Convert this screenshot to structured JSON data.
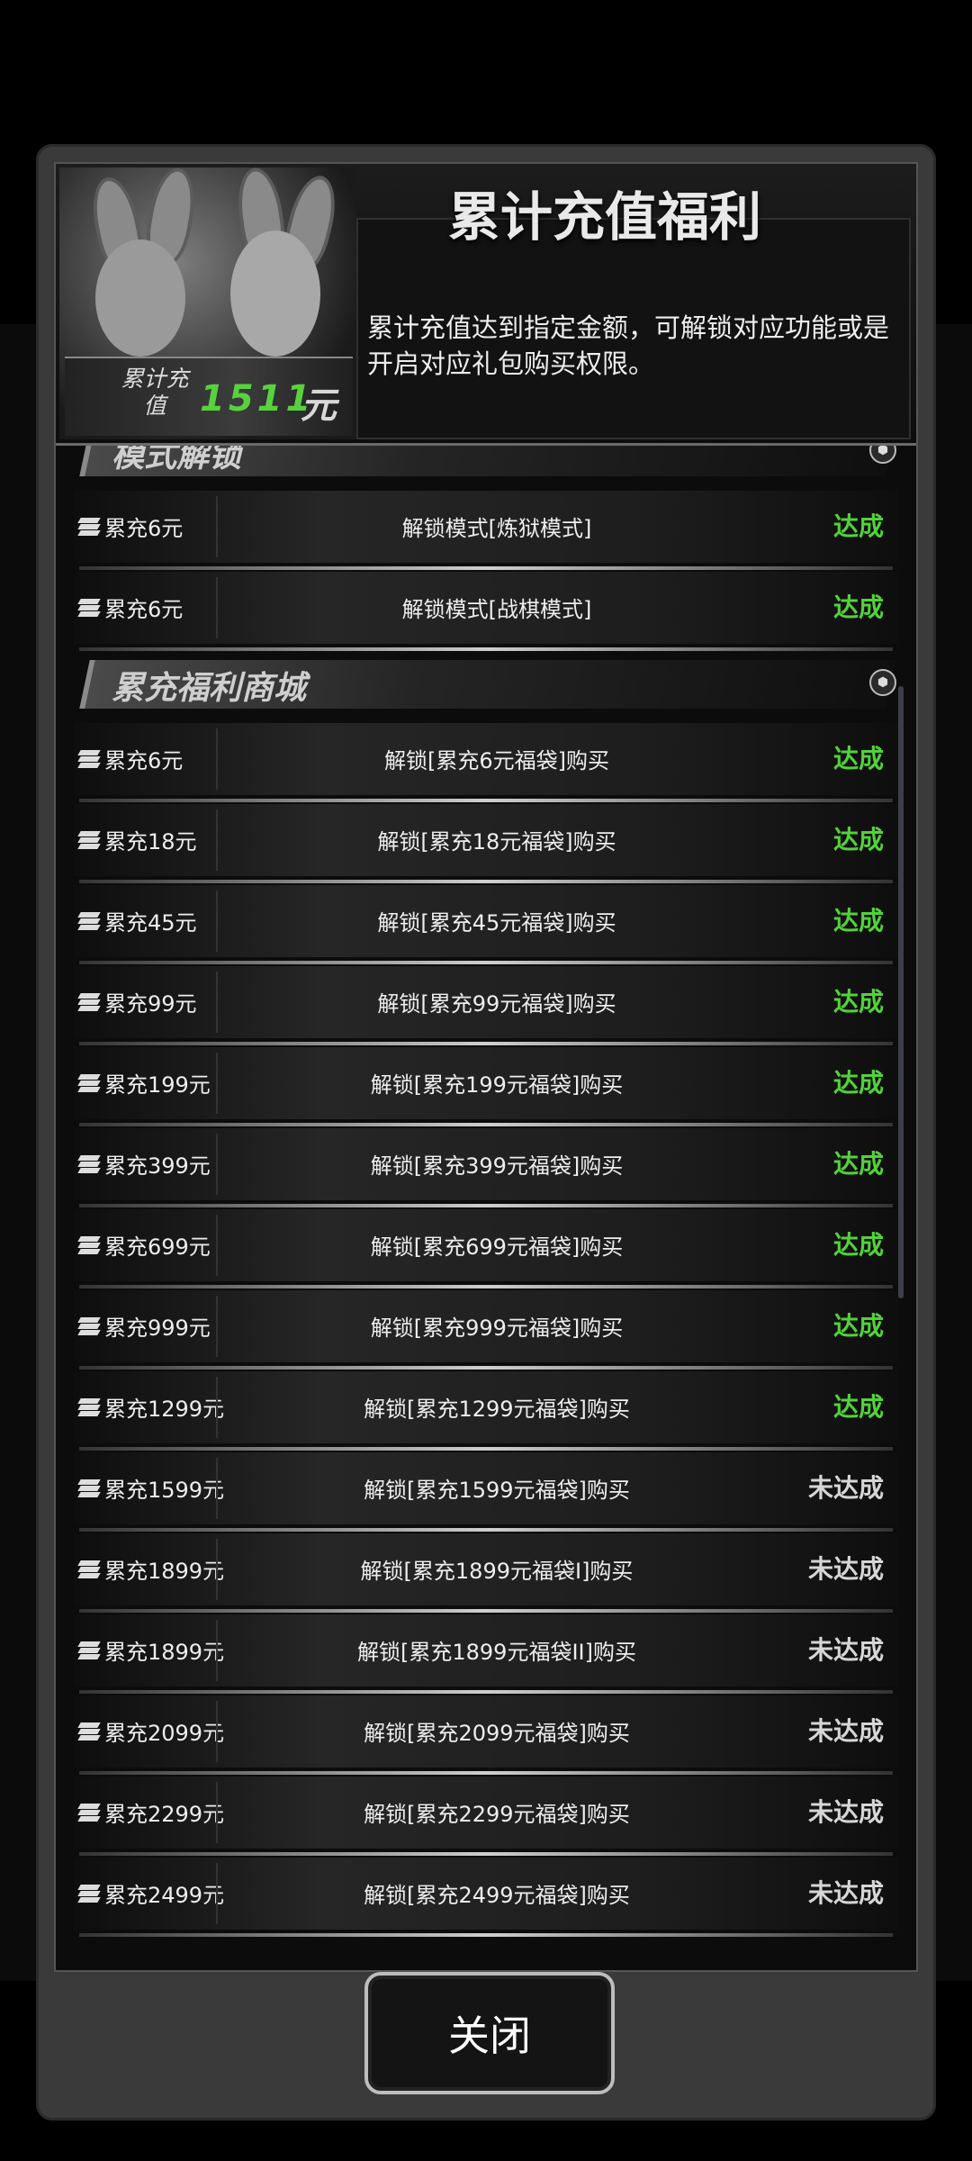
{
  "header": {
    "title": "累计充值福利",
    "description": "累计充值达到指定金额，可解锁对应功能或是开启对应礼包购买权限。",
    "recharge_label": "累计充值",
    "recharge_value": "1511",
    "recharge_unit": "元"
  },
  "sections": [
    {
      "title": "模式解锁",
      "rows": [
        {
          "req": "累充6元",
          "reward": "解锁模式[炼狱模式]",
          "status": "达成",
          "done": true
        },
        {
          "req": "累充6元",
          "reward": "解锁模式[战棋模式]",
          "status": "达成",
          "done": true
        }
      ]
    },
    {
      "title": "累充福利商城",
      "rows": [
        {
          "req": "累充6元",
          "reward": "解锁[累充6元福袋]购买",
          "status": "达成",
          "done": true
        },
        {
          "req": "累充18元",
          "reward": "解锁[累充18元福袋]购买",
          "status": "达成",
          "done": true
        },
        {
          "req": "累充45元",
          "reward": "解锁[累充45元福袋]购买",
          "status": "达成",
          "done": true
        },
        {
          "req": "累充99元",
          "reward": "解锁[累充99元福袋]购买",
          "status": "达成",
          "done": true
        },
        {
          "req": "累充199元",
          "reward": "解锁[累充199元福袋]购买",
          "status": "达成",
          "done": true
        },
        {
          "req": "累充399元",
          "reward": "解锁[累充399元福袋]购买",
          "status": "达成",
          "done": true
        },
        {
          "req": "累充699元",
          "reward": "解锁[累充699元福袋]购买",
          "status": "达成",
          "done": true
        },
        {
          "req": "累充999元",
          "reward": "解锁[累充999元福袋]购买",
          "status": "达成",
          "done": true
        },
        {
          "req": "累充1299元",
          "reward": "解锁[累充1299元福袋]购买",
          "status": "达成",
          "done": true
        },
        {
          "req": "累充1599元",
          "reward": "解锁[累充1599元福袋]购买",
          "status": "未达成",
          "done": false
        },
        {
          "req": "累充1899元",
          "reward": "解锁[累充1899元福袋I]购买",
          "status": "未达成",
          "done": false
        },
        {
          "req": "累充1899元",
          "reward": "解锁[累充1899元福袋II]购买",
          "status": "未达成",
          "done": false
        },
        {
          "req": "累充2099元",
          "reward": "解锁[累充2099元福袋]购买",
          "status": "未达成",
          "done": false
        },
        {
          "req": "累充2299元",
          "reward": "解锁[累充2299元福袋]购买",
          "status": "未达成",
          "done": false
        },
        {
          "req": "累充2499元",
          "reward": "解锁[累充2499元福袋]购买",
          "status": "未达成",
          "done": false
        }
      ]
    }
  ],
  "close_label": "关闭",
  "colors": {
    "done": "#52d23a",
    "todo": "#d6d6d6",
    "recharge_value": "#59d13e"
  }
}
